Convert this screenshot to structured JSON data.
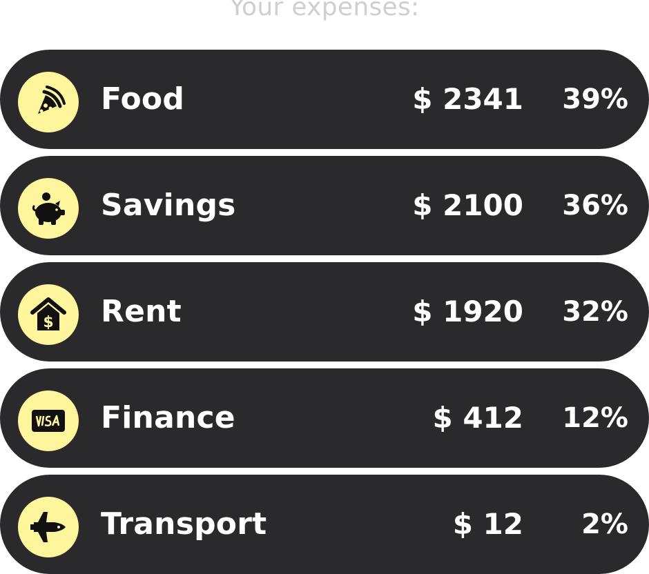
{
  "heading": "Your expenses:",
  "colors": {
    "row_background": "#2a2a2c",
    "icon_background": "#fff59d",
    "text": "#ffffff",
    "heading_text": "#cfcfcf"
  },
  "expenses": [
    {
      "icon": "pizza-icon",
      "label": "Food",
      "amount": "$ 2341",
      "percent": "39%"
    },
    {
      "icon": "piggy-bank-icon",
      "label": "Savings",
      "amount": "$ 2100",
      "percent": "36%"
    },
    {
      "icon": "house-dollar-icon",
      "label": "Rent",
      "amount": "$ 1920",
      "percent": "32%"
    },
    {
      "icon": "visa-card-icon",
      "label": "Finance",
      "amount": "$ 412",
      "percent": "12%"
    },
    {
      "icon": "space-shuttle-icon",
      "label": "Transport",
      "amount": "$ 12",
      "percent": "2%"
    }
  ]
}
